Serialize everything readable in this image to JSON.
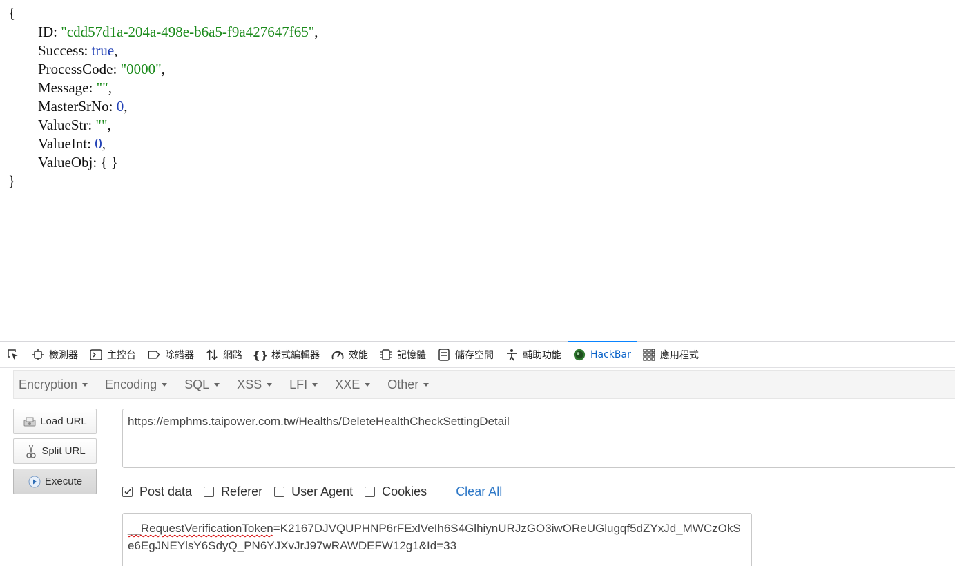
{
  "json_view": {
    "open_brace": "{",
    "close_brace": "}",
    "fields": [
      {
        "key": "ID",
        "value": "\"cdd57d1a-204a-498e-b6a5-f9a427647f65\"",
        "kind": "str"
      },
      {
        "key": "Success",
        "value": "true",
        "kind": "bool"
      },
      {
        "key": "ProcessCode",
        "value": "\"0000\"",
        "kind": "str"
      },
      {
        "key": "Message",
        "value": "\"\"",
        "kind": "str"
      },
      {
        "key": "MasterSrNo",
        "value": "0",
        "kind": "num"
      },
      {
        "key": "ValueStr",
        "value": "\"\"",
        "kind": "str"
      },
      {
        "key": "ValueInt",
        "value": "0",
        "kind": "num"
      },
      {
        "key": "ValueObj",
        "value": "{ }",
        "kind": "plain"
      }
    ]
  },
  "devtools": {
    "tabs": [
      {
        "label": "檢測器",
        "icon": "inspector-icon"
      },
      {
        "label": "主控台",
        "icon": "console-icon"
      },
      {
        "label": "除錯器",
        "icon": "debugger-icon"
      },
      {
        "label": "網路",
        "icon": "network-icon"
      },
      {
        "label": "樣式編輯器",
        "icon": "style-editor-icon"
      },
      {
        "label": "效能",
        "icon": "performance-icon"
      },
      {
        "label": "記憶體",
        "icon": "memory-icon"
      },
      {
        "label": "儲存空間",
        "icon": "storage-icon"
      },
      {
        "label": "輔助功能",
        "icon": "accessibility-icon"
      },
      {
        "label": "HackBar",
        "icon": "hackbar-icon"
      },
      {
        "label": "應用程式",
        "icon": "application-icon"
      }
    ],
    "active_tab": "HackBar",
    "active_color": "#0a84ff"
  },
  "hackbar": {
    "menus": [
      "Encryption",
      "Encoding",
      "SQL",
      "XSS",
      "LFI",
      "XXE",
      "Other"
    ],
    "buttons": {
      "load_url": "Load URL",
      "split_url": "Split URL",
      "execute": "Execute"
    },
    "url": "https://emphms.taipower.com.tw/Healths/DeleteHealthCheckSettingDetail",
    "options": [
      {
        "label": "Post data",
        "checked": true
      },
      {
        "label": "Referer",
        "checked": false
      },
      {
        "label": "User Agent",
        "checked": false
      },
      {
        "label": "Cookies",
        "checked": false
      }
    ],
    "clear_all": "Clear All",
    "post_data_prefix": "__RequestVerificationToken",
    "post_data_rest": "=K2167DJVQUPHNP6rFExlVeIh6S4GlhiynURJzGO3iwOReUGlugqf5dZYxJd_MWCzOkSe6EgJNEYlsY6SdyQ_PN6YJXvJrJ97wRAWDEFW12g1&Id=33"
  },
  "colors": {
    "string": "#1a8a1a",
    "number": "#1f3fb5",
    "link": "#2e78c7"
  }
}
